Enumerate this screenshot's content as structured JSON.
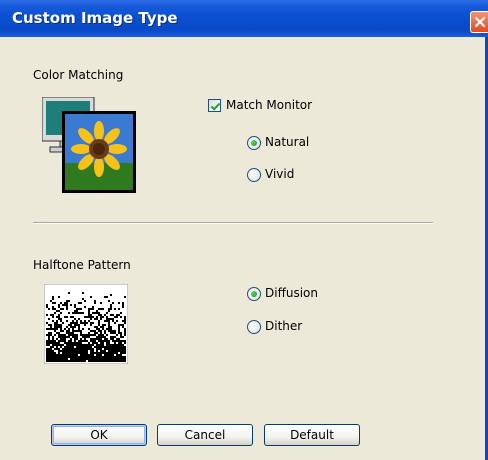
{
  "window": {
    "title": "Custom Image Type"
  },
  "color_matching": {
    "label": "Color Matching",
    "match_monitor": {
      "label": "Match Monitor",
      "checked": true
    },
    "options": [
      {
        "label": "Natural",
        "selected": true
      },
      {
        "label": "Vivid",
        "selected": false
      }
    ]
  },
  "halftone_pattern": {
    "label": "Halftone Pattern",
    "options": [
      {
        "label": "Diffusion",
        "selected": true
      },
      {
        "label": "Dither",
        "selected": false
      }
    ]
  },
  "buttons": {
    "ok": "OK",
    "cancel": "Cancel",
    "default": "Default"
  },
  "icons": {
    "close": "close-icon",
    "color_matching": "monitor-sunflower-icon",
    "halftone": "halftone-pattern-icon"
  },
  "colors": {
    "titlebar": "#0a4fd0",
    "dialog_bg": "#ece9d8",
    "radio_dot": "#21a121",
    "checkmark": "#21a121"
  }
}
